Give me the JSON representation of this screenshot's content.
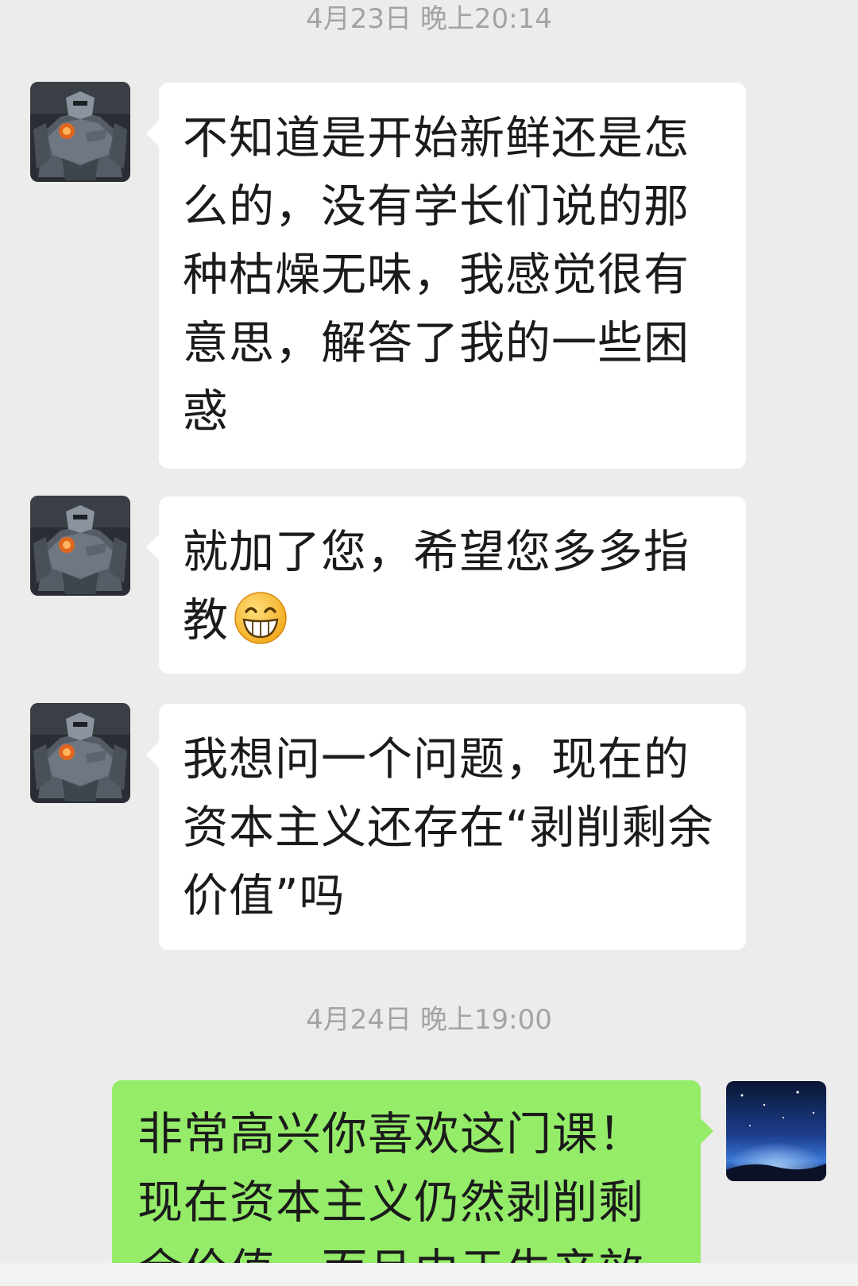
{
  "conversation": {
    "timestamp_1": "4月23日 晚上20:14",
    "timestamp_2": "4月24日 晚上19:00",
    "messages": [
      {
        "sender": "incoming",
        "text": "不知道是开始新鲜还是怎么的，没有学长们说的那种枯燥无味，我感觉很有意思，解答了我的一些困惑"
      },
      {
        "sender": "incoming",
        "text": "就加了您，希望您多多指教",
        "emoji": "grin-emoji"
      },
      {
        "sender": "incoming",
        "text": "我想问一个问题，现在的资本主义还存在“剥削剩余价值”吗"
      },
      {
        "sender": "outgoing",
        "text": "非常高兴你喜欢这门课！现在资本主义仍然剥削剩余价值，而且由于生产效"
      }
    ]
  },
  "avatars": {
    "incoming": "robot-mech-avatar",
    "outgoing": "night-sky-avatar"
  },
  "colors": {
    "background": "#ececec",
    "incoming_bubble": "#ffffff",
    "outgoing_bubble": "#95ec69",
    "timestamp_text": "#a3a3a3",
    "message_text": "#1b1b1b"
  }
}
